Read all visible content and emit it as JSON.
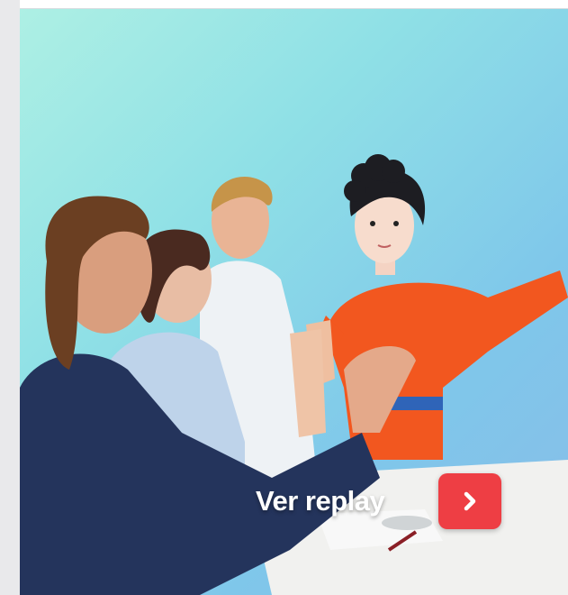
{
  "promo": {
    "cta_label": "Ver replay",
    "cta_icon": "chevron-right-icon",
    "accent_color": "#ee3e44"
  }
}
